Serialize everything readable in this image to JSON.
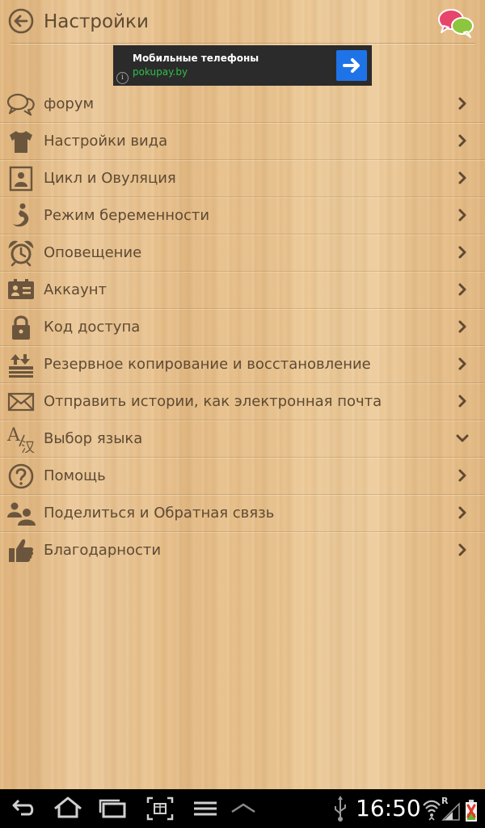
{
  "header": {
    "title": "Настройки",
    "back_icon": "back-arrow-icon",
    "chat_icon": "chat-bubbles-icon"
  },
  "ad": {
    "title": "Мобильные телефоны",
    "url": "pokupay.by",
    "info_glyph": "i",
    "arrow_icon": "arrow-right-icon",
    "colors": {
      "background": "#2b2b2b",
      "url": "#2fbf4a",
      "button": "#1e73e8"
    }
  },
  "menu": {
    "items": [
      {
        "label": "форум",
        "icon": "forum-icon",
        "chevron": "chevron-right-icon"
      },
      {
        "label": "Настройки вида",
        "icon": "tshirt-icon",
        "chevron": "chevron-right-icon"
      },
      {
        "label": "Цикл и Овуляция",
        "icon": "calendar-figure-icon",
        "chevron": "chevron-right-icon"
      },
      {
        "label": "Режим беременности",
        "icon": "pregnancy-icon",
        "chevron": "chevron-right-icon"
      },
      {
        "label": "Оповещение",
        "icon": "alarm-clock-icon",
        "chevron": "chevron-right-icon"
      },
      {
        "label": "Аккаунт",
        "icon": "id-card-icon",
        "chevron": "chevron-right-icon"
      },
      {
        "label": "Код доступа",
        "icon": "padlock-icon",
        "chevron": "chevron-right-icon"
      },
      {
        "label": "Резервное копирование и восстановление",
        "icon": "backup-icon",
        "chevron": "chevron-right-icon"
      },
      {
        "label": "Отправить истории, как электронная почта",
        "icon": "envelope-icon",
        "chevron": "chevron-right-icon"
      },
      {
        "label": "Выбор языка",
        "icon": "language-icon",
        "chevron": "chevron-down-icon"
      },
      {
        "label": "Помощь",
        "icon": "help-icon",
        "chevron": "chevron-right-icon"
      },
      {
        "label": "Поделиться и Обратная связь",
        "icon": "people-icon",
        "chevron": "chevron-right-icon"
      },
      {
        "label": "Благодарности",
        "icon": "thumbs-up-icon",
        "chevron": "chevron-right-icon"
      }
    ]
  },
  "language_icon_glyphs": {
    "latin": "A",
    "cjk": "汉"
  },
  "status_bar": {
    "time": "16:50",
    "network_badge": "R"
  },
  "colors": {
    "text": "#5e4a33",
    "wood": "#e6be8a",
    "icon": "#6b563d"
  }
}
